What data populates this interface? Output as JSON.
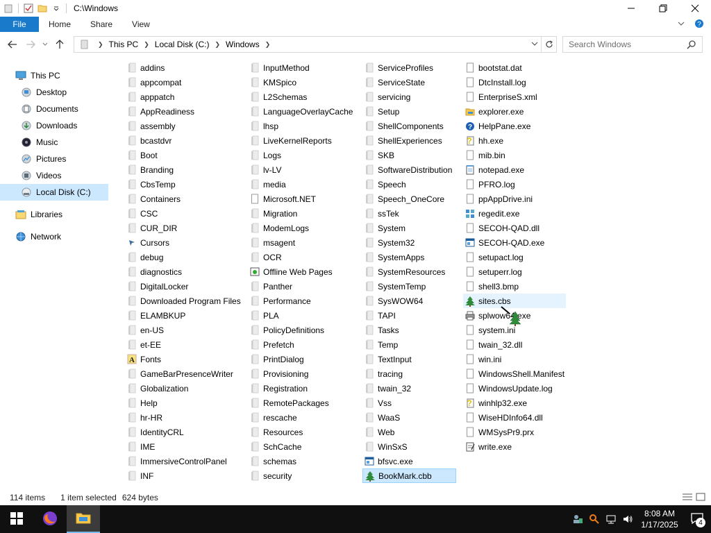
{
  "window": {
    "title": "C:\\Windows",
    "minimize": "—",
    "maximize": "☐",
    "close": "✕"
  },
  "ribbon": {
    "file": "File",
    "tabs": [
      "Home",
      "Share",
      "View"
    ]
  },
  "address": {
    "crumbs": [
      "This PC",
      "Local Disk (C:)",
      "Windows"
    ],
    "search_placeholder": "Search Windows"
  },
  "nav": [
    {
      "label": "This PC",
      "icon": "computer-icon"
    },
    {
      "label": "Desktop",
      "icon": "desktop-icon"
    },
    {
      "label": "Documents",
      "icon": "documents-icon"
    },
    {
      "label": "Downloads",
      "icon": "downloads-icon"
    },
    {
      "label": "Music",
      "icon": "music-icon"
    },
    {
      "label": "Pictures",
      "icon": "pictures-icon"
    },
    {
      "label": "Videos",
      "icon": "videos-icon"
    },
    {
      "label": "Local Disk (C:)",
      "icon": "drive-icon"
    },
    {
      "label": "Libraries",
      "icon": "libraries-icon"
    },
    {
      "label": "Network",
      "icon": "network-icon"
    }
  ],
  "columns": [
    [
      "addins",
      "appcompat",
      "apppatch",
      "AppReadiness",
      "assembly",
      "bcastdvr",
      "Boot",
      "Branding",
      "CbsTemp",
      "Containers",
      "CSC",
      "CUR_DIR",
      "Cursors",
      "debug",
      "diagnostics",
      "DigitalLocker",
      "Downloaded Program Files",
      "ELAMBKUP",
      "en-US",
      "et-EE",
      "Fonts",
      "GameBarPresenceWriter",
      "Globalization",
      "Help",
      "hr-HR",
      "IdentityCRL",
      "IME",
      "ImmersiveControlPanel",
      "INF"
    ],
    [
      "InputMethod",
      "KMSpico",
      "L2Schemas",
      "LanguageOverlayCache",
      "lhsp",
      "LiveKernelReports",
      "Logs",
      "lv-LV",
      "media",
      "Microsoft.NET",
      "Migration",
      "ModemLogs",
      "msagent",
      "OCR",
      "Offline Web Pages",
      "Panther",
      "Performance",
      "PLA",
      "PolicyDefinitions",
      "Prefetch",
      "PrintDialog",
      "Provisioning",
      "Registration",
      "RemotePackages",
      "rescache",
      "Resources",
      "SchCache",
      "schemas",
      "security"
    ],
    [
      "ServiceProfiles",
      "ServiceState",
      "servicing",
      "Setup",
      "ShellComponents",
      "ShellExperiences",
      "SKB",
      "SoftwareDistribution",
      "Speech",
      "Speech_OneCore",
      "ssTek",
      "System",
      "System32",
      "SystemApps",
      "SystemResources",
      "SystemTemp",
      "SysWOW64",
      "TAPI",
      "Tasks",
      "Temp",
      "TextInput",
      "tracing",
      "twain_32",
      "Vss",
      "WaaS",
      "Web",
      "WinSxS",
      "bfsvc.exe",
      "BookMark.cbb"
    ],
    [
      "bootstat.dat",
      "DtcInstall.log",
      "EnterpriseS.xml",
      "explorer.exe",
      "HelpPane.exe",
      "hh.exe",
      "mib.bin",
      "notepad.exe",
      "PFRO.log",
      "ppAppDrive.ini",
      "regedit.exe",
      "SECOH-QAD.dll",
      "SECOH-QAD.exe",
      "setupact.log",
      "setuperr.log",
      "shell3.bmp",
      "sites.cbs",
      "splwow64.exe",
      "system.ini",
      "twain_32.dll",
      "win.ini",
      "WindowsShell.Manifest",
      "WindowsUpdate.log",
      "winhlp32.exe",
      "WiseHDInfo64.dll",
      "WMSysPr9.prx",
      "write.exe"
    ]
  ],
  "special_icons": {
    "Cursors": "cursor-icon",
    "Fonts": "fonts-icon",
    "Offline Web Pages": "offline-pages-icon",
    "bfsvc.exe": "exe-icon",
    "BookMark.cbb": "tree-icon",
    "explorer.exe": "explorer-icon",
    "HelpPane.exe": "help-icon",
    "hh.exe": "help-doc-icon",
    "notepad.exe": "notepad-icon",
    "regedit.exe": "regedit-icon",
    "SECOH-QAD.exe": "exe-icon",
    "sites.cbs": "tree-icon",
    "splwow64.exe": "printer-icon",
    "winhlp32.exe": "help-doc-icon",
    "write.exe": "write-icon"
  },
  "selected_file": "BookMark.cbb",
  "hover_file": "sites.cbs",
  "status": {
    "items": "114 items",
    "selected": "1 item selected",
    "size": "624 bytes"
  },
  "taskbar": {
    "time": "8:08 AM",
    "date": "1/17/2025",
    "notifications": "4"
  },
  "colors": {
    "accent": "#1979ca",
    "selection": "#cce8ff",
    "taskbar": "#101010"
  }
}
